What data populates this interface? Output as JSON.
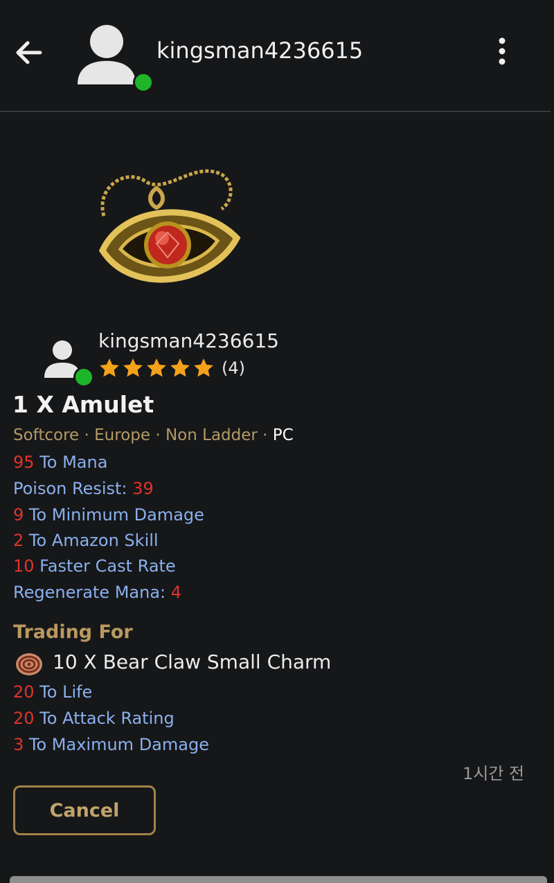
{
  "header": {
    "username": "kingsman4236615",
    "back_icon": "arrow-left-icon",
    "menu_icon": "more-vertical-icon",
    "online_color": "#1fb52a"
  },
  "item": {
    "image_icon": "amulet-icon",
    "seller": {
      "name": "kingsman4236615",
      "rating_stars": 5,
      "rating_count": "(4)"
    },
    "title": "1 X Amulet",
    "meta": {
      "mode": "Softcore",
      "region": "Europe",
      "ladder": "Non Ladder",
      "sep": " · ",
      "platform": "PC"
    },
    "stats": [
      {
        "num": "95",
        "text": " To Mana"
      },
      {
        "text": "Poison Resist: ",
        "num": "39"
      },
      {
        "num": "9",
        "text": " To Minimum Damage"
      },
      {
        "num": "2",
        "text": " To Amazon Skill"
      },
      {
        "num": "10",
        "text": " Faster Cast Rate"
      },
      {
        "text": "Regenerate Mana: ",
        "num": "4"
      }
    ]
  },
  "trade": {
    "heading": "Trading For",
    "charm_icon": "small-charm-icon",
    "title": "10 X Bear Claw Small Charm",
    "stats": [
      {
        "num": "20",
        "text": " To Life"
      },
      {
        "num": "20",
        "text": " To Attack Rating"
      },
      {
        "num": "3",
        "text": " To Maximum Damage"
      }
    ]
  },
  "timestamp": "1시간 전",
  "cancel_label": "Cancel",
  "colors": {
    "background": "#161719",
    "stat_text": "#8ab0ee",
    "stat_number": "#e0342c",
    "gold": "#b9995d",
    "star": "#f5a21b"
  }
}
